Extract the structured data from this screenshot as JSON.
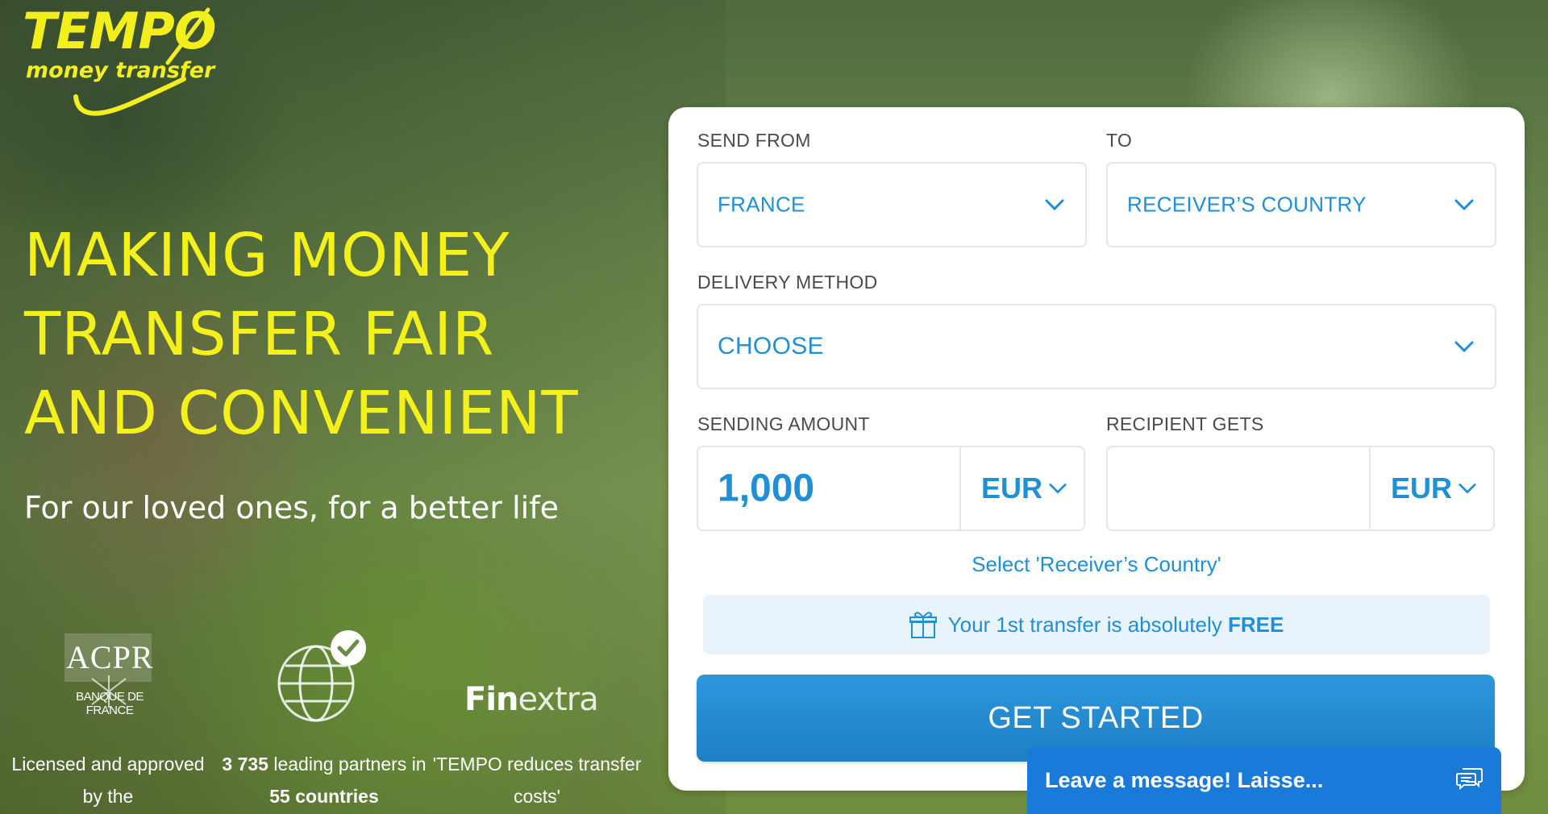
{
  "brand": {
    "logo_word": "TEMPO",
    "logo_sub": "money transfer",
    "yellow": "#f2ef1c",
    "accent_blue": "#1f8fd6",
    "cta_blue": "#2590d6"
  },
  "hero": {
    "headline_lines": [
      "MAKING MONEY",
      "TRANSFER FAIR",
      "AND CONVENIENT"
    ],
    "tagline": "For our loved ones, for a better life"
  },
  "badges": {
    "acpr_title": "ACPR",
    "acpr_sub": "BANQUE DE FRANCE",
    "finextra_bold": "Fin",
    "finextra_light": "extra",
    "captions": {
      "licensed": "Licensed and approved by the",
      "partners_count": "3 735",
      "partners_text": "leading partners in",
      "partners_countries": "55 countries",
      "quote": "'TEMPO reduces transfer costs'"
    }
  },
  "form": {
    "send_from_label": "SEND FROM",
    "send_from_value": "FRANCE",
    "to_label": "TO",
    "to_value": "RECEIVER’S COUNTRY",
    "delivery_label": "DELIVERY METHOD",
    "delivery_value": "CHOOSE",
    "sending_amount_label": "SENDING AMOUNT",
    "sending_amount_value": "1,000",
    "sending_currency": "EUR",
    "recipient_label": "RECIPIENT GETS",
    "recipient_value": "",
    "recipient_currency": "EUR",
    "hint": "Select 'Receiver’s Country'",
    "promo_text": "Your 1st transfer is absolutely",
    "promo_bold": "FREE",
    "cta": "GET STARTED"
  },
  "chat": {
    "label": "Leave a message! Laisse...",
    "icon": "chat-bubbles-icon"
  },
  "icons": [
    "chevron-down-icon",
    "gift-icon",
    "globe-check-icon",
    "chat-bubbles-icon"
  ]
}
